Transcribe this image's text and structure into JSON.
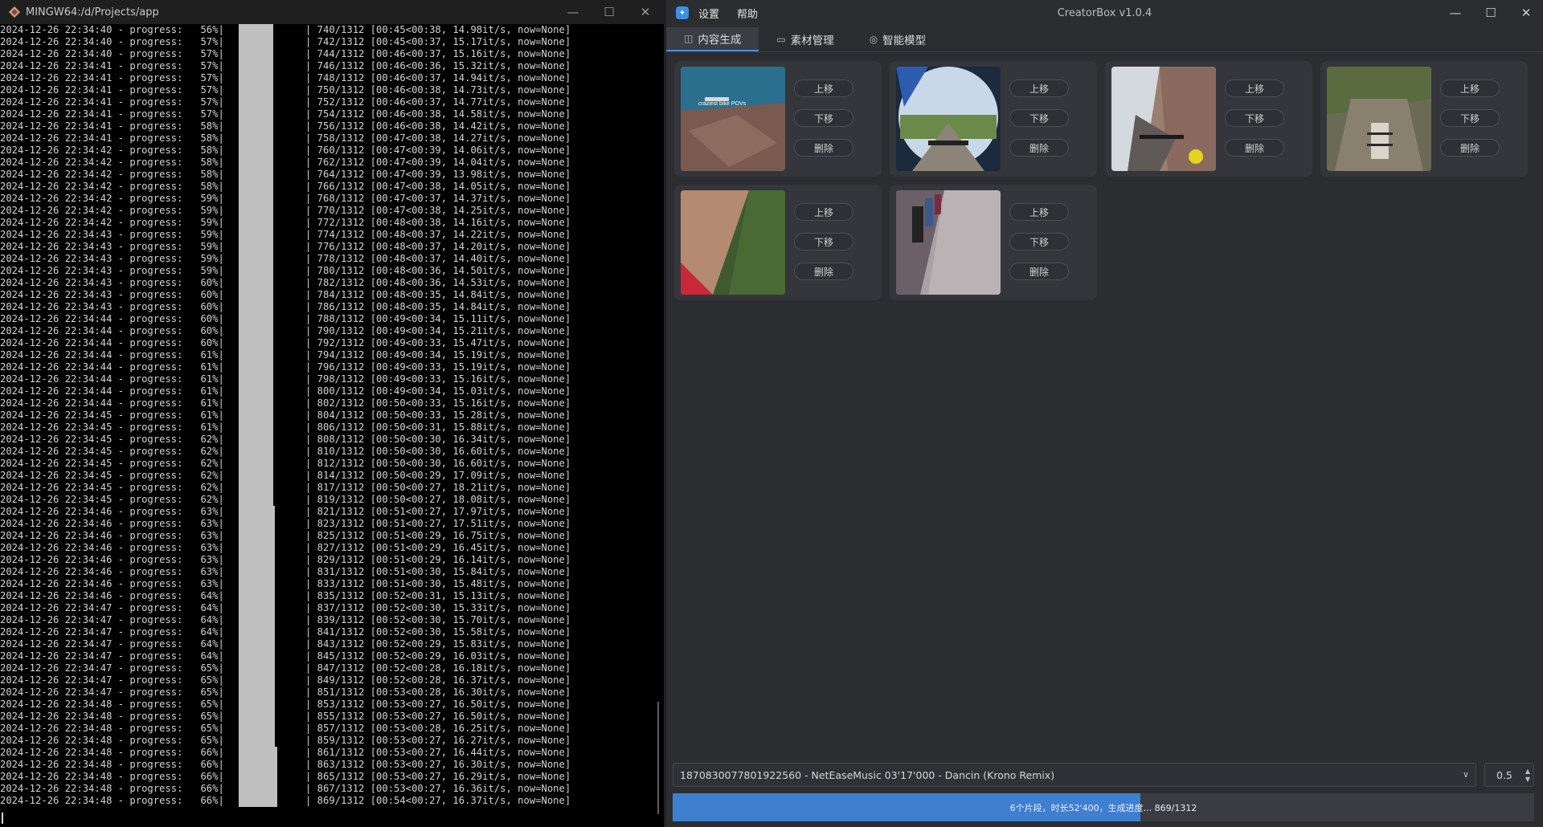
{
  "terminal": {
    "title": "MINGW64:/d/Projects/app",
    "window_controls": [
      "—",
      "☐",
      "✕"
    ],
    "lines": [
      {
        "ts": "2024-12-26 22:34:40",
        "pct": "56%",
        "bar": 0.43,
        "step": "740/1312",
        "eta": "[00:45<00:38, 14.98it/s, now=None]"
      },
      {
        "ts": "2024-12-26 22:34:40",
        "pct": "57%",
        "bar": 0.43,
        "step": "742/1312",
        "eta": "[00:45<00:37, 15.17it/s, now=None]"
      },
      {
        "ts": "2024-12-26 22:34:40",
        "pct": "57%",
        "bar": 0.43,
        "step": "744/1312",
        "eta": "[00:46<00:37, 15.16it/s, now=None]"
      },
      {
        "ts": "2024-12-26 22:34:41",
        "pct": "57%",
        "bar": 0.43,
        "step": "746/1312",
        "eta": "[00:46<00:36, 15.32it/s, now=None]"
      },
      {
        "ts": "2024-12-26 22:34:41",
        "pct": "57%",
        "bar": 0.43,
        "step": "748/1312",
        "eta": "[00:46<00:37, 14.94it/s, now=None]"
      },
      {
        "ts": "2024-12-26 22:34:41",
        "pct": "57%",
        "bar": 0.43,
        "step": "750/1312",
        "eta": "[00:46<00:38, 14.73it/s, now=None]"
      },
      {
        "ts": "2024-12-26 22:34:41",
        "pct": "57%",
        "bar": 0.43,
        "step": "752/1312",
        "eta": "[00:46<00:37, 14.77it/s, now=None]"
      },
      {
        "ts": "2024-12-26 22:34:41",
        "pct": "57%",
        "bar": 0.43,
        "step": "754/1312",
        "eta": "[00:46<00:38, 14.58it/s, now=None]"
      },
      {
        "ts": "2024-12-26 22:34:41",
        "pct": "58%",
        "bar": 0.43,
        "step": "756/1312",
        "eta": "[00:46<00:38, 14.42it/s, now=None]"
      },
      {
        "ts": "2024-12-26 22:34:41",
        "pct": "58%",
        "bar": 0.43,
        "step": "758/1312",
        "eta": "[00:47<00:38, 14.27it/s, now=None]"
      },
      {
        "ts": "2024-12-26 22:34:42",
        "pct": "58%",
        "bar": 0.43,
        "step": "760/1312",
        "eta": "[00:47<00:39, 14.06it/s, now=None]"
      },
      {
        "ts": "2024-12-26 22:34:42",
        "pct": "58%",
        "bar": 0.43,
        "step": "762/1312",
        "eta": "[00:47<00:39, 14.04it/s, now=None]"
      },
      {
        "ts": "2024-12-26 22:34:42",
        "pct": "58%",
        "bar": 0.43,
        "step": "764/1312",
        "eta": "[00:47<00:39, 13.98it/s, now=None]"
      },
      {
        "ts": "2024-12-26 22:34:42",
        "pct": "58%",
        "bar": 0.43,
        "step": "766/1312",
        "eta": "[00:47<00:38, 14.05it/s, now=None]"
      },
      {
        "ts": "2024-12-26 22:34:42",
        "pct": "59%",
        "bar": 0.43,
        "step": "768/1312",
        "eta": "[00:47<00:37, 14.37it/s, now=None]"
      },
      {
        "ts": "2024-12-26 22:34:42",
        "pct": "59%",
        "bar": 0.43,
        "step": "770/1312",
        "eta": "[00:47<00:38, 14.25it/s, now=None]"
      },
      {
        "ts": "2024-12-26 22:34:42",
        "pct": "59%",
        "bar": 0.43,
        "step": "772/1312",
        "eta": "[00:48<00:38, 14.16it/s, now=None]"
      },
      {
        "ts": "2024-12-26 22:34:43",
        "pct": "59%",
        "bar": 0.43,
        "step": "774/1312",
        "eta": "[00:48<00:37, 14.22it/s, now=None]"
      },
      {
        "ts": "2024-12-26 22:34:43",
        "pct": "59%",
        "bar": 0.43,
        "step": "776/1312",
        "eta": "[00:48<00:37, 14.20it/s, now=None]"
      },
      {
        "ts": "2024-12-26 22:34:43",
        "pct": "59%",
        "bar": 0.43,
        "step": "778/1312",
        "eta": "[00:48<00:37, 14.40it/s, now=None]"
      },
      {
        "ts": "2024-12-26 22:34:43",
        "pct": "59%",
        "bar": 0.43,
        "step": "780/1312",
        "eta": "[00:48<00:36, 14.50it/s, now=None]"
      },
      {
        "ts": "2024-12-26 22:34:43",
        "pct": "60%",
        "bar": 0.43,
        "step": "782/1312",
        "eta": "[00:48<00:36, 14.53it/s, now=None]"
      },
      {
        "ts": "2024-12-26 22:34:43",
        "pct": "60%",
        "bar": 0.43,
        "step": "784/1312",
        "eta": "[00:48<00:35, 14.84it/s, now=None]"
      },
      {
        "ts": "2024-12-26 22:34:43",
        "pct": "60%",
        "bar": 0.43,
        "step": "786/1312",
        "eta": "[00:48<00:35, 14.84it/s, now=None]"
      },
      {
        "ts": "2024-12-26 22:34:44",
        "pct": "60%",
        "bar": 0.43,
        "step": "788/1312",
        "eta": "[00:49<00:34, 15.11it/s, now=None]"
      },
      {
        "ts": "2024-12-26 22:34:44",
        "pct": "60%",
        "bar": 0.43,
        "step": "790/1312",
        "eta": "[00:49<00:34, 15.21it/s, now=None]"
      },
      {
        "ts": "2024-12-26 22:34:44",
        "pct": "60%",
        "bar": 0.43,
        "step": "792/1312",
        "eta": "[00:49<00:33, 15.47it/s, now=None]"
      },
      {
        "ts": "2024-12-26 22:34:44",
        "pct": "61%",
        "bar": 0.43,
        "step": "794/1312",
        "eta": "[00:49<00:34, 15.19it/s, now=None]"
      },
      {
        "ts": "2024-12-26 22:34:44",
        "pct": "61%",
        "bar": 0.43,
        "step": "796/1312",
        "eta": "[00:49<00:33, 15.19it/s, now=None]"
      },
      {
        "ts": "2024-12-26 22:34:44",
        "pct": "61%",
        "bar": 0.43,
        "step": "798/1312",
        "eta": "[00:49<00:33, 15.16it/s, now=None]"
      },
      {
        "ts": "2024-12-26 22:34:44",
        "pct": "61%",
        "bar": 0.43,
        "step": "800/1312",
        "eta": "[00:49<00:34, 15.03it/s, now=None]"
      },
      {
        "ts": "2024-12-26 22:34:44",
        "pct": "61%",
        "bar": 0.43,
        "step": "802/1312",
        "eta": "[00:50<00:33, 15.16it/s, now=None]"
      },
      {
        "ts": "2024-12-26 22:34:45",
        "pct": "61%",
        "bar": 0.43,
        "step": "804/1312",
        "eta": "[00:50<00:33, 15.28it/s, now=None]"
      },
      {
        "ts": "2024-12-26 22:34:45",
        "pct": "61%",
        "bar": 0.43,
        "step": "806/1312",
        "eta": "[00:50<00:31, 15.88it/s, now=None]"
      },
      {
        "ts": "2024-12-26 22:34:45",
        "pct": "62%",
        "bar": 0.43,
        "step": "808/1312",
        "eta": "[00:50<00:30, 16.34it/s, now=None]"
      },
      {
        "ts": "2024-12-26 22:34:45",
        "pct": "62%",
        "bar": 0.43,
        "step": "810/1312",
        "eta": "[00:50<00:30, 16.60it/s, now=None]"
      },
      {
        "ts": "2024-12-26 22:34:45",
        "pct": "62%",
        "bar": 0.43,
        "step": "812/1312",
        "eta": "[00:50<00:30, 16.60it/s, now=None]"
      },
      {
        "ts": "2024-12-26 22:34:45",
        "pct": "62%",
        "bar": 0.43,
        "step": "814/1312",
        "eta": "[00:50<00:29, 17.09it/s, now=None]"
      },
      {
        "ts": "2024-12-26 22:34:45",
        "pct": "62%",
        "bar": 0.43,
        "step": "817/1312",
        "eta": "[00:50<00:27, 18.21it/s, now=None]"
      },
      {
        "ts": "2024-12-26 22:34:45",
        "pct": "62%",
        "bar": 0.43,
        "step": "819/1312",
        "eta": "[00:50<00:27, 18.08it/s, now=None]"
      },
      {
        "ts": "2024-12-26 22:34:46",
        "pct": "63%",
        "bar": 0.45,
        "step": "821/1312",
        "eta": "[00:51<00:27, 17.97it/s, now=None]"
      },
      {
        "ts": "2024-12-26 22:34:46",
        "pct": "63%",
        "bar": 0.45,
        "step": "823/1312",
        "eta": "[00:51<00:27, 17.51it/s, now=None]"
      },
      {
        "ts": "2024-12-26 22:34:46",
        "pct": "63%",
        "bar": 0.45,
        "step": "825/1312",
        "eta": "[00:51<00:29, 16.75it/s, now=None]"
      },
      {
        "ts": "2024-12-26 22:34:46",
        "pct": "63%",
        "bar": 0.45,
        "step": "827/1312",
        "eta": "[00:51<00:29, 16.45it/s, now=None]"
      },
      {
        "ts": "2024-12-26 22:34:46",
        "pct": "63%",
        "bar": 0.45,
        "step": "829/1312",
        "eta": "[00:51<00:29, 16.14it/s, now=None]"
      },
      {
        "ts": "2024-12-26 22:34:46",
        "pct": "63%",
        "bar": 0.45,
        "step": "831/1312",
        "eta": "[00:51<00:30, 15.84it/s, now=None]"
      },
      {
        "ts": "2024-12-26 22:34:46",
        "pct": "63%",
        "bar": 0.45,
        "step": "833/1312",
        "eta": "[00:51<00:30, 15.48it/s, now=None]"
      },
      {
        "ts": "2024-12-26 22:34:46",
        "pct": "64%",
        "bar": 0.45,
        "step": "835/1312",
        "eta": "[00:52<00:31, 15.13it/s, now=None]"
      },
      {
        "ts": "2024-12-26 22:34:47",
        "pct": "64%",
        "bar": 0.45,
        "step": "837/1312",
        "eta": "[00:52<00:30, 15.33it/s, now=None]"
      },
      {
        "ts": "2024-12-26 22:34:47",
        "pct": "64%",
        "bar": 0.45,
        "step": "839/1312",
        "eta": "[00:52<00:30, 15.70it/s, now=None]"
      },
      {
        "ts": "2024-12-26 22:34:47",
        "pct": "64%",
        "bar": 0.45,
        "step": "841/1312",
        "eta": "[00:52<00:30, 15.58it/s, now=None]"
      },
      {
        "ts": "2024-12-26 22:34:47",
        "pct": "64%",
        "bar": 0.45,
        "step": "843/1312",
        "eta": "[00:52<00:29, 15.83it/s, now=None]"
      },
      {
        "ts": "2024-12-26 22:34:47",
        "pct": "64%",
        "bar": 0.45,
        "step": "845/1312",
        "eta": "[00:52<00:29, 16.03it/s, now=None]"
      },
      {
        "ts": "2024-12-26 22:34:47",
        "pct": "65%",
        "bar": 0.45,
        "step": "847/1312",
        "eta": "[00:52<00:28, 16.18it/s, now=None]"
      },
      {
        "ts": "2024-12-26 22:34:47",
        "pct": "65%",
        "bar": 0.45,
        "step": "849/1312",
        "eta": "[00:52<00:28, 16.37it/s, now=None]"
      },
      {
        "ts": "2024-12-26 22:34:47",
        "pct": "65%",
        "bar": 0.45,
        "step": "851/1312",
        "eta": "[00:53<00:28, 16.30it/s, now=None]"
      },
      {
        "ts": "2024-12-26 22:34:48",
        "pct": "65%",
        "bar": 0.45,
        "step": "853/1312",
        "eta": "[00:53<00:27, 16.50it/s, now=None]"
      },
      {
        "ts": "2024-12-26 22:34:48",
        "pct": "65%",
        "bar": 0.45,
        "step": "855/1312",
        "eta": "[00:53<00:27, 16.50it/s, now=None]"
      },
      {
        "ts": "2024-12-26 22:34:48",
        "pct": "65%",
        "bar": 0.45,
        "step": "857/1312",
        "eta": "[00:53<00:28, 16.25it/s, now=None]"
      },
      {
        "ts": "2024-12-26 22:34:48",
        "pct": "65%",
        "bar": 0.45,
        "step": "859/1312",
        "eta": "[00:53<00:27, 16.27it/s, now=None]"
      },
      {
        "ts": "2024-12-26 22:34:48",
        "pct": "66%",
        "bar": 0.48,
        "step": "861/1312",
        "eta": "[00:53<00:27, 16.44it/s, now=None]"
      },
      {
        "ts": "2024-12-26 22:34:48",
        "pct": "66%",
        "bar": 0.48,
        "step": "863/1312",
        "eta": "[00:53<00:27, 16.30it/s, now=None]"
      },
      {
        "ts": "2024-12-26 22:34:48",
        "pct": "66%",
        "bar": 0.48,
        "step": "865/1312",
        "eta": "[00:53<00:27, 16.29it/s, now=None]"
      },
      {
        "ts": "2024-12-26 22:34:48",
        "pct": "66%",
        "bar": 0.48,
        "step": "867/1312",
        "eta": "[00:53<00:27, 16.36it/s, now=None]"
      },
      {
        "ts": "2024-12-26 22:34:48",
        "pct": "66%",
        "bar": 0.48,
        "step": "869/1312",
        "eta": "[00:54<00:27, 16.37it/s, now=None]"
      }
    ]
  },
  "app": {
    "title": "CreatorBox v1.0.4",
    "menu": [
      "设置",
      "帮助"
    ],
    "window_controls": [
      "—",
      "☐",
      "✕"
    ],
    "tabs": [
      {
        "label": "内容生成",
        "icon": "camera-icon",
        "active": true
      },
      {
        "label": "素材管理",
        "icon": "box-icon",
        "active": false
      },
      {
        "label": "智能模型",
        "icon": "ai-icon",
        "active": false
      }
    ],
    "clip_buttons": {
      "up": "上移",
      "down": "下移",
      "delete": "删除"
    },
    "clips": [
      {
        "caption": "craziest bike POVs",
        "scene": "lake-cliff"
      },
      {
        "caption": "",
        "scene": "fisheye-path"
      },
      {
        "caption": "",
        "scene": "mountain-rock"
      },
      {
        "caption": "",
        "scene": "rocky-descent"
      },
      {
        "caption": "",
        "scene": "red-edge"
      },
      {
        "caption": "",
        "scene": "crowd-path"
      }
    ],
    "music_select": "1870830077801922560 - NetEaseMusic 03'17'000 - Dancin (Krono Remix)",
    "spin_value": "0.5",
    "progress": {
      "fraction": 0.543,
      "text": "6个片段，时长52'400，生成进度... 869/1312"
    },
    "colors": {
      "accent": "#3f7fd0",
      "tab_underline": "#4a90e2"
    }
  }
}
